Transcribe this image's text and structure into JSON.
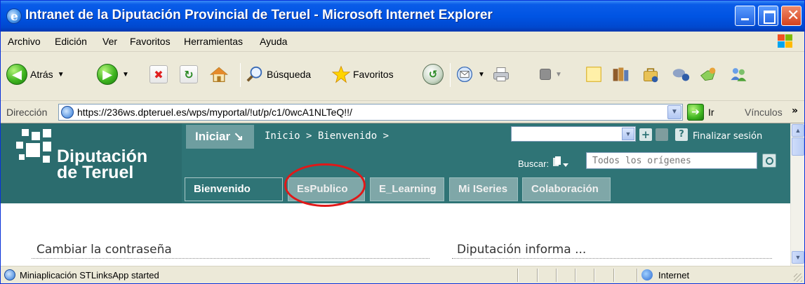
{
  "window": {
    "title": "Intranet de la Diputación Provincial de Teruel - Microsoft Internet Explorer",
    "close_glyph": "✕"
  },
  "menu": {
    "items": [
      "Archivo",
      "Edición",
      "Ver",
      "Favoritos",
      "Herramientas",
      "Ayuda"
    ]
  },
  "toolbar": {
    "back_label": "Atrás",
    "search_label": "Búsqueda",
    "favorites_label": "Favoritos"
  },
  "address": {
    "label": "Dirección",
    "url": "https://236ws.dpteruel.es/wps/myportal/!ut/p/c1/0wcA1NLTeQ!!/",
    "go_label": "Ir",
    "links_label": "Vínculos"
  },
  "portal": {
    "logo_line1": "Diputación",
    "logo_line2": "de Teruel",
    "start_button": "Iniciar ↘",
    "breadcrumb": "Inicio > Bienvenido >",
    "logout": "Finalizar sesión",
    "search_label": "Buscar:",
    "search_placeholder": "Todos los orígenes",
    "tabs": [
      "Bienvenido",
      "EsPublico",
      "E_Learning",
      "Mi ISeries",
      "Colaboración"
    ],
    "active_tab": "Bienvenido",
    "portlets": [
      "Cambiar la contraseña",
      "Diputación informa ..."
    ]
  },
  "status": {
    "text": "Miniaplicación STLinksApp started",
    "zone": "Internet"
  },
  "colors": {
    "portal_teal": "#2b6c6e",
    "highlight": "#e01818",
    "xp_blue": "#0054e3"
  }
}
